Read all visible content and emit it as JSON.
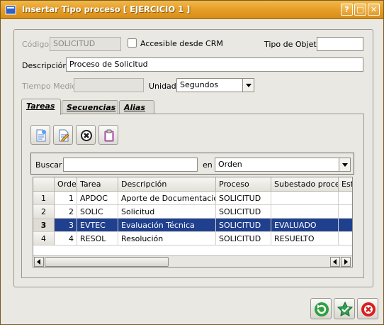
{
  "window": {
    "title": "Insertar Tipo proceso [ EJERCICIO 1 ]",
    "buttons": {
      "help": "?",
      "maximize": "□",
      "close": "✕"
    },
    "accent": "#e7a02a"
  },
  "form": {
    "codigo_label": "Código",
    "codigo_value": "SOLICITUD",
    "crm_label": "Accesible desde CRM",
    "crm_checked": false,
    "tipo_objeto_label": "Tipo de Objeto",
    "tipo_objeto_value": "",
    "descripcion_label": "Descripción",
    "descripcion_value": "Proceso de Solicitud",
    "tiempo_medio_label": "Tiempo Medio",
    "tiempo_medio_value": "",
    "unidad_label": "Unidad",
    "unidad_value": "Segundos"
  },
  "tabs": [
    {
      "label": "Tareas",
      "active": true
    },
    {
      "label": "Secuencias",
      "active": false
    },
    {
      "label": "Alias",
      "active": false
    }
  ],
  "toolbar_icons": [
    "new-document-icon",
    "edit-document-icon",
    "delete-icon",
    "paste-icon"
  ],
  "search": {
    "buscar_label": "Buscar",
    "buscar_value": "",
    "en_label": "en",
    "en_value": "Orden"
  },
  "table": {
    "columns": [
      "Orden",
      "Tarea",
      "Descripción",
      "Proceso",
      "Subestado proceso",
      "Estado"
    ],
    "rows": [
      {
        "n": "1",
        "orden": "1",
        "tarea": "APDOC",
        "descripcion": "Aporte de Documentación",
        "proceso": "SOLICITUD",
        "subestado": "",
        "selected": false
      },
      {
        "n": "2",
        "orden": "2",
        "tarea": "SOLIC",
        "descripcion": "Solicitud",
        "proceso": "SOLICITUD",
        "subestado": "",
        "selected": false
      },
      {
        "n": "3",
        "orden": "3",
        "tarea": "EVTEC",
        "descripcion": "Evaluación Técnica",
        "proceso": "SOLICITUD",
        "subestado": "EVALUADO",
        "selected": true
      },
      {
        "n": "4",
        "orden": "4",
        "tarea": "RESOL",
        "descripcion": "Resolución",
        "proceso": "SOLICITUD",
        "subestado": "RESUELTO",
        "selected": false
      }
    ],
    "selection_color": "#1f3f8f"
  },
  "bottom_buttons": [
    "refresh-icon",
    "accept-icon",
    "cancel-icon"
  ]
}
